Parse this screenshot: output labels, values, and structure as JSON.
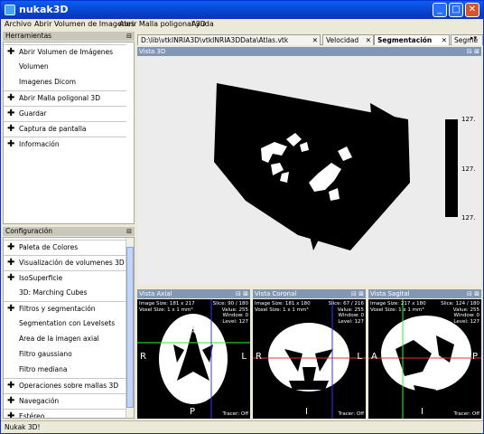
{
  "window": {
    "title": "nukak3D"
  },
  "menu": [
    "Archivo",
    "Abrir Volumen de Imagenes",
    "Abrir Malla poligonal 3D",
    "Ayuda"
  ],
  "tools": {
    "header": "Herramientas",
    "items": [
      {
        "label": "Abrir Volumen de Imágenes",
        "type": "group"
      },
      {
        "label": "Volumen",
        "type": "sub"
      },
      {
        "label": "Imagenes Dicom",
        "type": "sub"
      },
      {
        "label": "Abrir Malla poligonal 3D",
        "type": "group"
      },
      {
        "label": "Guardar",
        "type": "group"
      },
      {
        "label": "Captura de pantalla",
        "type": "group"
      },
      {
        "label": "Información",
        "type": "group"
      }
    ]
  },
  "config": {
    "header": "Configuración",
    "items": [
      {
        "label": "Paleta de Colores",
        "type": "group"
      },
      {
        "label": "Visualización de volumenes 3D",
        "type": "group"
      },
      {
        "label": "IsoSuperficie",
        "type": "group"
      },
      {
        "label": "3D: Marching Cubes",
        "type": "sub"
      },
      {
        "label": "Filtros y segmentación",
        "type": "group"
      },
      {
        "label": "Segmentation con Levelsets",
        "type": "sub"
      },
      {
        "label": "Area de la imagen axial",
        "type": "sub"
      },
      {
        "label": "Filtro gaussiano",
        "type": "sub"
      },
      {
        "label": "Filtro mediana",
        "type": "sub"
      },
      {
        "label": "Operaciones sobre mallas 3D",
        "type": "group"
      },
      {
        "label": "Navegación",
        "type": "group"
      },
      {
        "label": "Estéreo",
        "type": "group"
      },
      {
        "label": "Colisiones",
        "type": "group"
      }
    ]
  },
  "tabs": [
    {
      "label": "D:\\lib\\vtkINRIA3D\\vtkINRIA3DData\\Atlas.vtk",
      "active": false
    },
    {
      "label": "Velocidad",
      "active": false
    },
    {
      "label": "Segmentación",
      "active": true
    },
    {
      "label": "Segme",
      "active": false
    }
  ],
  "view3d": {
    "title": "Vista 3D",
    "scale_labels": [
      "127.",
      "127.",
      "127."
    ]
  },
  "slices": [
    {
      "title": "Vista Axial",
      "left": "Image Size: 181 x 217\nVoxel Size: 1 x 1 mm³",
      "right": "Slice: 90 / 180\nValue: 255\nWindow: 0\nLevel: 127",
      "tracer": "Tracer: Off",
      "o": {
        "top": "A",
        "left": "R",
        "right": "L",
        "bottom": "P"
      }
    },
    {
      "title": "Vista Coronal",
      "left": "Image Size: 181 x 180\nVoxel Size: 1 x 1 mm³",
      "right": "Slice: 67 / 216\nValue: 255\nWindow: 0\nLevel: 127",
      "tracer": "Tracer: Off",
      "o": {
        "top": "S",
        "left": "R",
        "right": "L",
        "bottom": "I"
      }
    },
    {
      "title": "Vista Sagital",
      "left": "Image Size: 217 x 180\nVoxel Size: 1 x 1 mm³",
      "right": "Slice: 124 / 180\nValue: 255\nWindow: 0\nLevel: 127",
      "tracer": "Tracer: Off",
      "o": {
        "top": "S",
        "left": "A",
        "right": "P",
        "bottom": "I"
      }
    }
  ],
  "status": "Nukak 3D!"
}
